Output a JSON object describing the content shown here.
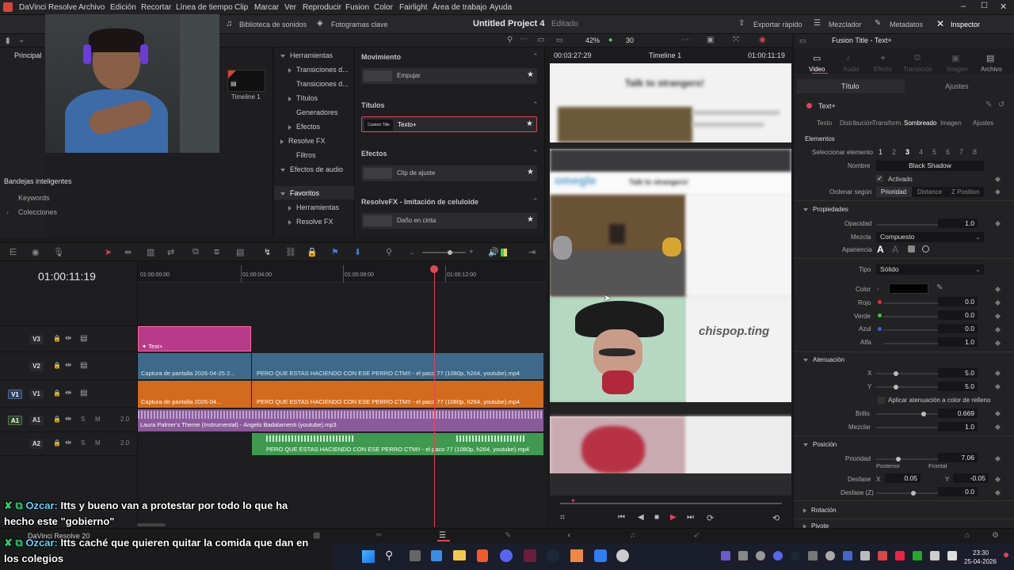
{
  "menu": {
    "app": "DaVinci Resolve",
    "items": [
      "Archivo",
      "Edición",
      "Recortar",
      "Línea de tiempo",
      "Clip",
      "Marcar",
      "Ver",
      "Reproducir",
      "Fusion",
      "Color",
      "Fairlight",
      "Área de trabajo",
      "Ayuda"
    ]
  },
  "toolbar": {
    "sound_library": "Biblioteca de sonidos",
    "keyframes": "Fotogramas clave",
    "project_title": "Untitled Project 4",
    "project_state": "Editado",
    "quick_export": "Exportar rápido",
    "mixer": "Mezclador",
    "metadata": "Metadatos",
    "inspector": "Inspector"
  },
  "media": {
    "tab_main": "Principal",
    "timeline_thumb": "Timeline 1",
    "smart_bins": "Bandejas inteligentes",
    "keywords": "Keywords",
    "collections": "Colecciones"
  },
  "effects_tree": {
    "items": [
      {
        "label": "Herramientas",
        "indent": 0,
        "arrow": "down"
      },
      {
        "label": "Transiciones d...",
        "indent": 1,
        "arrow": "right"
      },
      {
        "label": "Transiciones d...",
        "indent": 1,
        "arrow": "none"
      },
      {
        "label": "Títulos",
        "indent": 1,
        "arrow": "right"
      },
      {
        "label": "Generadores",
        "indent": 1,
        "arrow": "none"
      },
      {
        "label": "Efectos",
        "indent": 1,
        "arrow": "right"
      },
      {
        "label": "Resolve FX",
        "indent": 0,
        "arrow": "down"
      },
      {
        "label": "Filtros",
        "indent": 1,
        "arrow": "none"
      },
      {
        "label": "Efectos de audio",
        "indent": 0,
        "arrow": "down"
      },
      {
        "label": "Favoritos",
        "indent": 0,
        "arrow": "down",
        "selected": true
      },
      {
        "label": "Herramientas",
        "indent": 1,
        "arrow": "right"
      },
      {
        "label": "Resolve FX",
        "indent": 1,
        "arrow": "right"
      }
    ]
  },
  "effects_list": {
    "sections": [
      {
        "title": "Movimiento",
        "item": "Empujar",
        "thumb": ""
      },
      {
        "title": "Títulos",
        "item": "Texto+",
        "thumb": "Custom Title",
        "selected": true
      },
      {
        "title": "Efectos",
        "item": "Clip de ajuste",
        "thumb": ""
      },
      {
        "title": "ResolveFX - Imitación de celuloide",
        "item": "Daño en cinta",
        "thumb": ""
      }
    ]
  },
  "viewer": {
    "zoom": "42%",
    "fps": "30",
    "timecode_left": "00:03:27:29",
    "timeline_name": "Timeline 1",
    "timecode_right": "01:00:11:19",
    "watermark": "chispop.ting",
    "sites": [
      "Talk to strangers!",
      "omegle",
      "Talk to strangers!"
    ]
  },
  "timeline": {
    "timecode": "01:00:11:19",
    "ruler": [
      "01:00:00:00",
      "01:00:04:00",
      "01:00:08:00",
      "01:00:12:00"
    ],
    "tracks": [
      {
        "id": "V3",
        "patch": ""
      },
      {
        "id": "V2",
        "patch": ""
      },
      {
        "id": "V1",
        "patch": "V1"
      },
      {
        "id": "A1",
        "patch": "A1",
        "level": "2.0"
      },
      {
        "id": "A2",
        "patch": "",
        "level": "2.0"
      }
    ],
    "clips": {
      "v3_title": "Text+",
      "v2_a": "Captura de pantalla 2026-04-25 2...",
      "v2_b": "PERO QUE ESTAS HACIENDO CON ESE PERRO CTM!! - el paco 77 (1080p, h264, youtube).mp4",
      "v1_a": "Captura de pantalla 2026-04...",
      "v1_b": "PERO QUE ESTAS HACIENDO CON ESE PERRO CTM!! - el paco 77 (1080p, h264, youtube).mp4",
      "a1": "Laura Palmer's Theme (Instrumental) - Angelo Badalamenti (youtube).mp3",
      "a2": "PERO QUE ESTAS HACIENDO CON ESE PERRO CTM!! - el paco 77 (1080p, h264, youtube).mp4"
    }
  },
  "inspector": {
    "title": "Fusion Title - Text+",
    "tabs": [
      "Video",
      "Audio",
      "Efecto",
      "Transición",
      "Imagen",
      "Archivo"
    ],
    "subtabs": [
      "Título",
      "Ajustes"
    ],
    "node": "Text+",
    "text_tabs": [
      "Texto",
      "Distribución",
      "Transform.",
      "Sombreado",
      "Imagen",
      "Ajustes"
    ],
    "elements_label": "Elementos",
    "select_element_label": "Seleccionar elemento",
    "element_numbers": [
      "1",
      "2",
      "3",
      "4",
      "5",
      "6",
      "7",
      "8"
    ],
    "name_label": "Nombre",
    "name_value": "Black Shadow",
    "enabled_label": "Activado",
    "order_label": "Ordenar según",
    "order_options": [
      "Prioridad",
      "Distance",
      "Z Position"
    ],
    "props_title": "Propiedades",
    "opacity_label": "Opacidad",
    "opacity": "1.0",
    "blend_label": "Mezcla",
    "blend": "Compuesto",
    "appearance_label": "Apariencia",
    "type_label": "Tipo",
    "type": "Sólido",
    "color_label": "Color",
    "red_label": "Rojo",
    "red": "0.0",
    "green_label": "Verde",
    "green": "0.0",
    "blue_label": "Azul",
    "blue": "0.0",
    "alpha_label": "Alfa",
    "alpha": "1.0",
    "soft_title": "Atenuación",
    "x_label": "X",
    "x": "5.0",
    "y_label": "Y",
    "y": "5.0",
    "apply_soft": "Aplicar atenuación a color de relleno",
    "glow_label": "Brillo",
    "glow": "0.669",
    "blend2_label": "Mezclar",
    "blend2": "1.0",
    "pos_title": "Posición",
    "priority_label": "Prioridad",
    "priority": "7.06",
    "back_label": "Posterior",
    "front_label": "Frontal",
    "offset_label": "Desfase",
    "offset_x_label": "X",
    "offset_x": "0.05",
    "offset_y_label": "Y",
    "offset_y": "-0.05",
    "offset_z_label": "Desfase (Z)",
    "offset_z": "0.0",
    "rotation_title": "Rotación",
    "pivot_title": "Pivote"
  },
  "chat": {
    "msg1_user": "Ozcar:",
    "msg1_text": "Itts y bueno van a protestar por todo lo que ha",
    "msg1_text2": "hecho este \"gobierno\"",
    "msg2_user": "Ozcar:",
    "msg2_text": "Itts caché que quieren quitar la comida que dan en",
    "msg2_text2": "los colegios"
  },
  "bottom": {
    "version": "DaVinci Resolve 20"
  },
  "taskbar": {
    "time": "23:30",
    "date": "25-04-2026"
  }
}
